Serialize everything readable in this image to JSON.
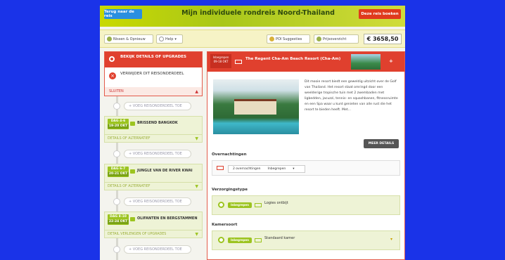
{
  "header": {
    "back_label": "Terug naar de reis",
    "title": "Mijn individuele rondreis Noord-Thailand",
    "book_label": "Deze reis boeken"
  },
  "toolbar": {
    "share_label": "Nissen & Opnieuw",
    "help_label": "Help",
    "poi_label": "POI Suggesties",
    "prijs_label": "Prijsoverzicht",
    "price": "€ 3658,50"
  },
  "sidebar": {
    "details_label": "BEKIJK DETAILS OF UPGRADES",
    "remove_label": "VERWIJDER DIT REISONDERDEEL",
    "close_label": "SLUITEN",
    "add_label": "+ VOEG REISONDERDEEL TOE",
    "stages": [
      {
        "day": "DAG 4-6",
        "date": "19-20 OKT",
        "name": "BRISSEND BANGKOK",
        "footer": "DETAILS OF ALTERNATIEF"
      },
      {
        "day": "DAG 6-7",
        "date": "20-21 OKT",
        "name": "JUNGLE VAN DE RIVER KWAI",
        "footer": "DETAILS OF ALTERNATIEF"
      },
      {
        "day": "DAG 8-10",
        "date": "22-24 OKT",
        "name": "OLIFANTEN EN BERGSTAMMEN",
        "footer": "DETAIL VERLENGEN OF UPGRADES"
      }
    ]
  },
  "main": {
    "tag_line1": "Inbegrepen",
    "tag_line2": "09-18 OKT",
    "title": "The Regent Cha-Am Beach Resort (Cha-Am)",
    "description": "Dit mooie resort biedt een geweldig uitzicht over de Golf van Thailand. Het resort staat omringd door een weelderige tropische tuin met 2 zwembaden met ligbedden, jacuzzi, tennis- en squashbanen, fitnessruimte en een Spa waar u kunt genieten van alle rust die het resort te bieden heeft. Met...",
    "more_label": "MEER DETAILS",
    "overnachtingen_label": "Overnachtingen",
    "nights_value": "2 overnachtingen",
    "nights_status": "Inbegrepen",
    "verzorging_label": "Verzorgingstype",
    "verzorging_pill": "Inbegrepen",
    "verzorging_value": "Logies ontbijt",
    "kamer_label": "Kamersoort",
    "kamer_pill": "Inbegrepen",
    "kamer_value": "Standaard kamer"
  }
}
